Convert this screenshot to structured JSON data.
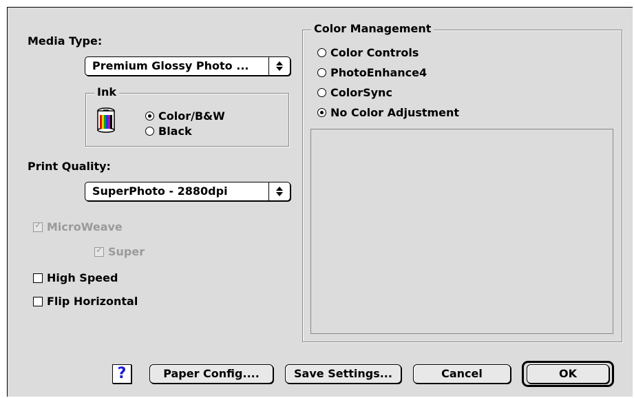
{
  "left": {
    "media_type_label": "Media Type:",
    "media_type_value": "Premium Glossy Photo ...",
    "ink_group_title": "Ink",
    "ink_options": [
      {
        "label": "Color/B&W",
        "selected": true
      },
      {
        "label": "Black",
        "selected": false
      }
    ],
    "print_quality_label": "Print Quality:",
    "print_quality_value": "SuperPhoto - 2880dpi",
    "microweave_label": "MicroWeave",
    "super_label": "Super",
    "high_speed_label": "High Speed",
    "flip_horizontal_label": "Flip Horizontal"
  },
  "color_management": {
    "title": "Color Management",
    "options": [
      {
        "label": "Color Controls",
        "selected": false
      },
      {
        "label": "PhotoEnhance4",
        "selected": false
      },
      {
        "label": "ColorSync",
        "selected": false
      },
      {
        "label": "No Color Adjustment",
        "selected": true
      }
    ]
  },
  "buttons": {
    "help": "?",
    "paper_config": "Paper Config....",
    "save_settings": "Save Settings...",
    "cancel": "Cancel",
    "ok": "OK"
  },
  "colors": {
    "background": "#dcdcdc",
    "help_question": "#1a1adb",
    "disabled_text": "#9a9a9a"
  }
}
